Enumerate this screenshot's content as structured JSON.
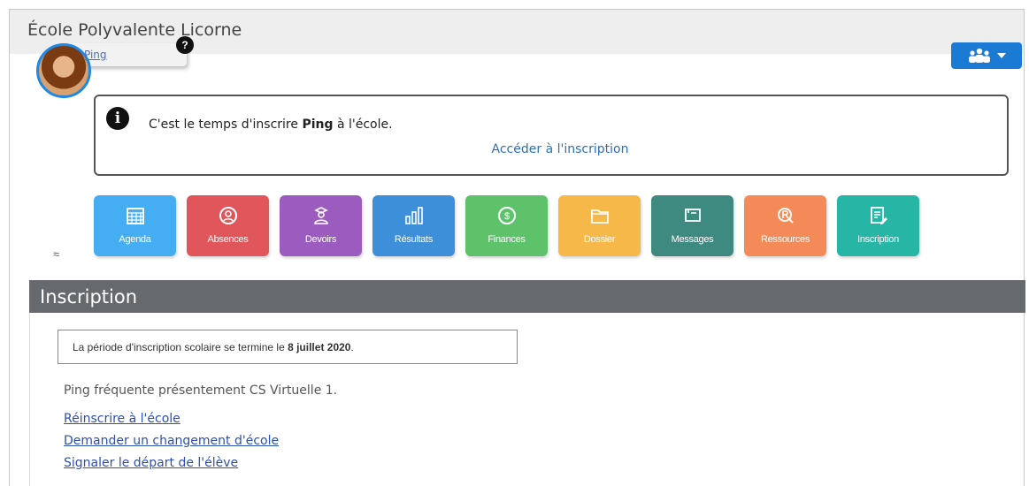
{
  "school": {
    "name": "École Polyvalente Licorne"
  },
  "student": {
    "name": "Ping",
    "help_badge": "?"
  },
  "header": {
    "group_button_icon": "users-icon",
    "dropdown_icon": "caret-down-icon"
  },
  "notice": {
    "prefix": "C'est le temps d'inscrire ",
    "student": "Ping",
    "suffix": " à l'école.",
    "link": "Accéder à l'inscription"
  },
  "tiles": [
    {
      "label": "Agenda",
      "icon": "calendar-icon",
      "color": "#45aef2"
    },
    {
      "label": "Absences",
      "icon": "person-circle-icon",
      "color": "#e0565a"
    },
    {
      "label": "Devoirs",
      "icon": "student-icon",
      "color": "#9c5cbf"
    },
    {
      "label": "Résultats",
      "icon": "bar-chart-icon",
      "color": "#3c8fd8"
    },
    {
      "label": "Finances",
      "icon": "coin-icon",
      "color": "#5ec26b"
    },
    {
      "label": "Dossier",
      "icon": "folder-icon",
      "color": "#f7b84a"
    },
    {
      "label": "Messages",
      "icon": "message-icon",
      "color": "#3f8a80"
    },
    {
      "label": "Ressources",
      "icon": "resource-icon",
      "color": "#f48a58"
    },
    {
      "label": "Inscription",
      "icon": "form-icon",
      "color": "#27b5a6"
    }
  ],
  "collapse_icon": "≈",
  "section": {
    "title": "Inscription",
    "period_prefix": "La période d'inscription scolaire se termine le ",
    "period_date": "8 juillet 2020",
    "period_suffix": ".",
    "attends": "Ping fréquente présentement CS Virtuelle 1.",
    "links": [
      "Réinscrire à l'école",
      "Demander un changement d'école",
      "Signaler le départ de l'élève"
    ]
  }
}
